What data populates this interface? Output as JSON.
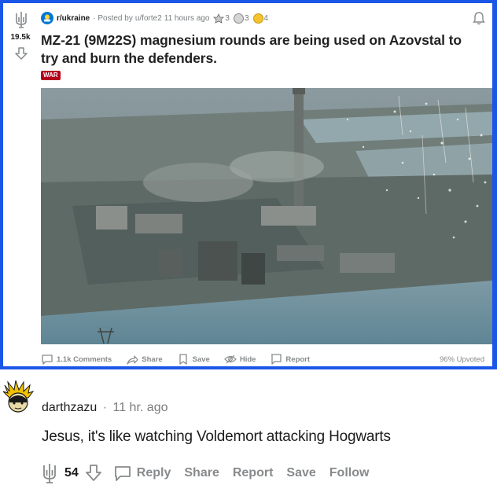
{
  "post": {
    "subreddit": "r/ukraine",
    "meta_prefix": "· Posted by",
    "author": "u/forte2",
    "age": "11 hours ago",
    "awards": [
      {
        "icon": "award-icon-silver",
        "count": "3"
      },
      {
        "icon": "award-icon-dollar",
        "count": "3"
      },
      {
        "icon": "award-icon-gold",
        "count": "4"
      }
    ],
    "votes": "19.5k",
    "title": "MZ-21 (9M22S) magnesium rounds are being used on Azovstal to try and burn the defenders.",
    "flair": "WAR",
    "flair_color": "#b3001b",
    "image_alt": "aerial-industrial-plant-with-incendiary-sparks",
    "actions": {
      "comments": "1.1k Comments",
      "share": "Share",
      "save": "Save",
      "hide": "Hide",
      "report": "Report"
    },
    "upvoted": "96% Upvoted"
  },
  "comment": {
    "author": "darthzazu",
    "separator": "·",
    "age": "11 hr. ago",
    "body": "Jesus, it's like watching Voldemort attacking Hogwarts",
    "score": "54",
    "actions": {
      "reply": "Reply",
      "share": "Share",
      "report": "Report",
      "save": "Save",
      "follow": "Follow"
    }
  },
  "colors": {
    "frame_blue": "#1a56e8",
    "meta_gray": "#787c7e",
    "action_gray": "#878a8c"
  }
}
